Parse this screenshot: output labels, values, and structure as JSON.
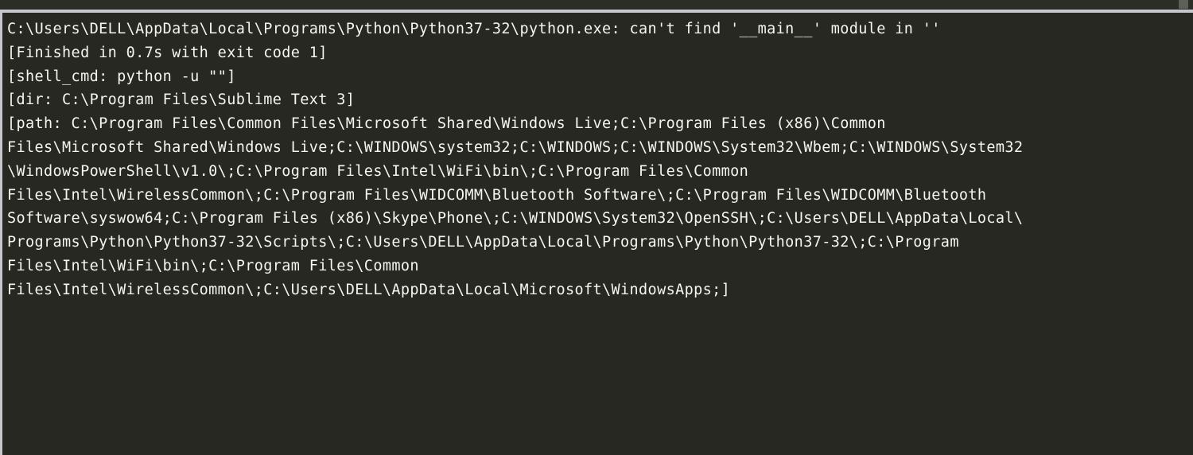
{
  "window": {
    "app": "Sublime Text 3",
    "panel_name": "build-output-console",
    "theme": "monokai-dark"
  },
  "colors": {
    "console_background": "#272822",
    "console_text": "#f6f5ee",
    "chrome_background": "#2b2d27",
    "divider": "#c6c7cd",
    "scrollbar_thumb": "#5d5f58"
  },
  "console": {
    "lines": [
      "C:\\Users\\DELL\\AppData\\Local\\Programs\\Python\\Python37-32\\python.exe: can't find '__main__' module in ''",
      "[Finished in 0.7s with exit code 1]",
      "[shell_cmd: python -u \"\"]",
      "[dir: C:\\Program Files\\Sublime Text 3]",
      "[path: C:\\Program Files\\Common Files\\Microsoft Shared\\Windows Live;C:\\Program Files (x86)\\Common",
      "Files\\Microsoft Shared\\Windows Live;C:\\WINDOWS\\system32;C:\\WINDOWS;C:\\WINDOWS\\System32\\Wbem;C:\\WINDOWS\\System32",
      "\\WindowsPowerShell\\v1.0\\;C:\\Program Files\\Intel\\WiFi\\bin\\;C:\\Program Files\\Common",
      "Files\\Intel\\WirelessCommon\\;C:\\Program Files\\WIDCOMM\\Bluetooth Software\\;C:\\Program Files\\WIDCOMM\\Bluetooth",
      "Software\\syswow64;C:\\Program Files (x86)\\Skype\\Phone\\;C:\\WINDOWS\\System32\\OpenSSH\\;C:\\Users\\DELL\\AppData\\Local\\",
      "Programs\\Python\\Python37-32\\Scripts\\;C:\\Users\\DELL\\AppData\\Local\\Programs\\Python\\Python37-32\\;C:\\Program",
      "Files\\Intel\\WiFi\\bin\\;C:\\Program Files\\Common",
      "Files\\Intel\\WirelessCommon\\;C:\\Users\\DELL\\AppData\\Local\\Microsoft\\WindowsApps;]"
    ],
    "error_message": "can't find '__main__' module in ''",
    "finished_status": "[Finished in 0.7s with exit code 1]",
    "exit_code": "1",
    "duration": "0.7s",
    "shell_cmd": "python -u \"\"",
    "working_dir": "C:\\Program Files\\Sublime Text 3",
    "python_executable": "C:\\Users\\DELL\\AppData\\Local\\Programs\\Python\\Python37-32\\python.exe"
  }
}
